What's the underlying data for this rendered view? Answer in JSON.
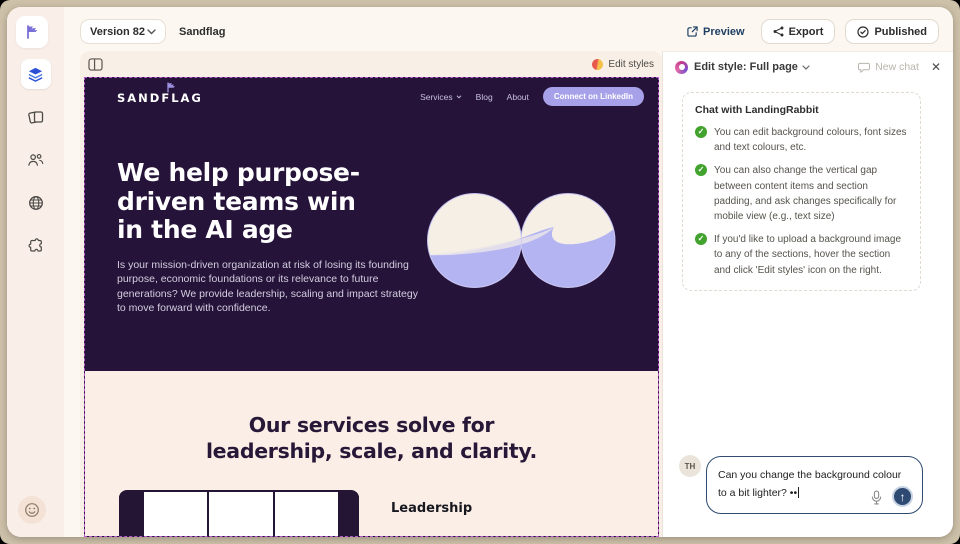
{
  "toolbar": {
    "version_label": "Version 82",
    "project_name": "Sandflag",
    "preview_label": "Preview",
    "export_label": "Export",
    "published_label": "Published"
  },
  "canvas": {
    "edit_styles_label": "Edit styles"
  },
  "site": {
    "brand": "SANDFLAG",
    "nav": [
      "Services",
      "Blog",
      "About"
    ],
    "cta_label": "Connect on LinkedIn",
    "hero_heading_lines": [
      "We help purpose-",
      "driven teams win",
      "in the AI age"
    ],
    "hero_paragraph": "Is your mission-driven organization at risk of losing its founding purpose, economic foundations or its relevance to future generations? We provide leadership, scaling and impact strategy to move forward with confidence.",
    "services_heading_lines": [
      "Our services solve for",
      "leadership, scale, and clarity."
    ],
    "leadership_label": "Leadership"
  },
  "panel": {
    "title": "Edit style: Full page",
    "new_chat_label": "New chat",
    "card_title": "Chat with LandingRabbit",
    "tips": [
      "You can edit background colours, font sizes and text colours, etc.",
      "You can also change the vertical gap between content items and section padding, and ask changes specifically for mobile view (e.g., text size)",
      "If you'd like to upload a background image to any of the sections, hover the section and click 'Edit styles' icon on the right."
    ],
    "avatar_initials": "TH",
    "input_text": "Can you change the background colour to a bit lighter? ••"
  },
  "icons": {
    "close": "✕",
    "send_arrow": "↑",
    "check": "✓"
  },
  "colors": {
    "frame": "#cec1a9",
    "app_bg": "#fcf7f1",
    "sidebar_bg": "#f9efe8",
    "hero_bg": "#251339",
    "services_bg": "#fbeee7",
    "selection_dash": "#b85bce",
    "cta_pill": "#a7a1e9",
    "check_green": "#42a22e",
    "send_navy": "#2e4a72",
    "preview_text": "#1d3f63",
    "art_cream": "#f5efe5",
    "art_periwinkle": "#b4b4f2"
  }
}
